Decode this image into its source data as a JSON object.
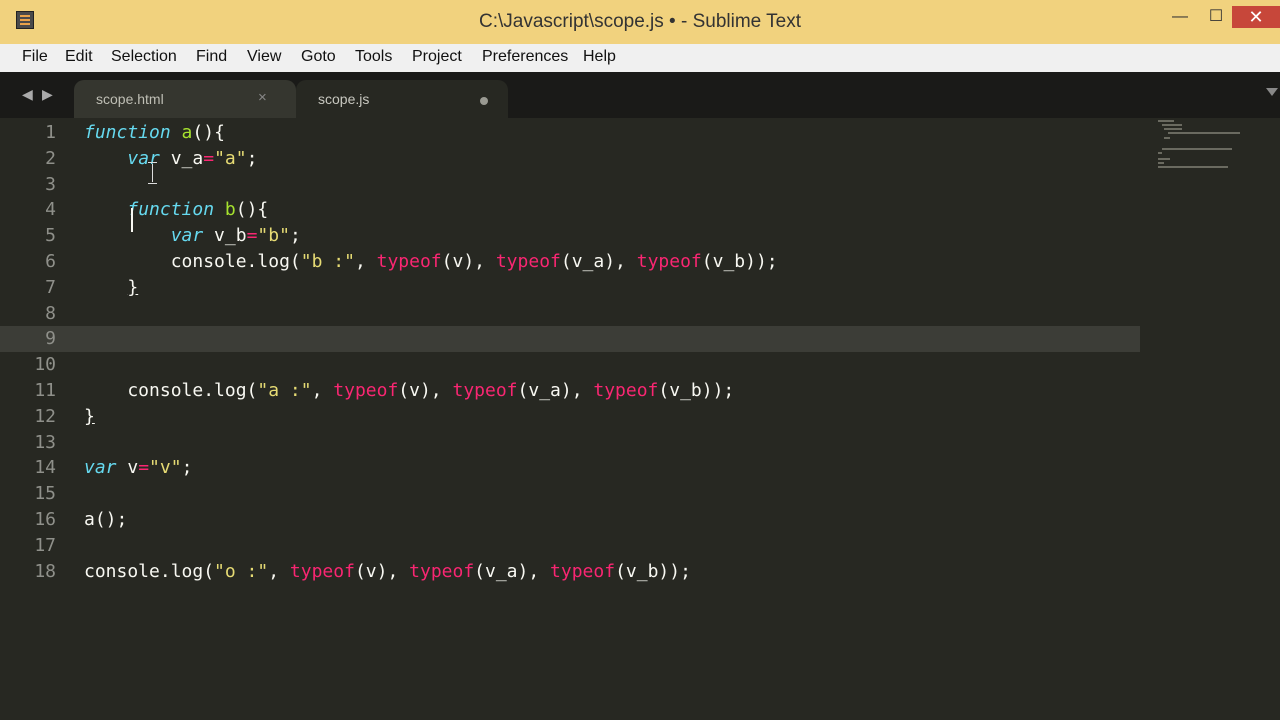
{
  "window": {
    "title": "C:\\Javascript\\scope.js • - Sublime Text",
    "buttons": {
      "minimize": "—",
      "maximize": "☐",
      "close": "✕"
    }
  },
  "menu": [
    "File",
    "Edit",
    "Selection",
    "Find",
    "View",
    "Goto",
    "Tools",
    "Project",
    "Preferences",
    "Help"
  ],
  "tabs": [
    {
      "label": "scope.html",
      "state": "saved",
      "close_glyph": "×"
    },
    {
      "label": "scope.js",
      "state": "modified"
    }
  ],
  "nav": {
    "back": "◀",
    "forward": "▶"
  },
  "editor": {
    "current_line": 9,
    "lines": [
      [
        {
          "t": "k",
          "v": "function"
        },
        {
          "t": "p",
          "v": " "
        },
        {
          "t": "f",
          "v": "a"
        },
        {
          "t": "p",
          "v": "(){"
        }
      ],
      [
        {
          "t": "p",
          "v": "    "
        },
        {
          "t": "k",
          "v": "var"
        },
        {
          "t": "p",
          "v": " v_a"
        },
        {
          "t": "o",
          "v": "="
        },
        {
          "t": "s",
          "v": "\"a\""
        },
        {
          "t": "p",
          "v": ";"
        }
      ],
      [],
      [
        {
          "t": "p",
          "v": "    "
        },
        {
          "t": "k",
          "v": "function"
        },
        {
          "t": "p",
          "v": " "
        },
        {
          "t": "f",
          "v": "b"
        },
        {
          "t": "p",
          "v": "(){"
        }
      ],
      [
        {
          "t": "p",
          "v": "        "
        },
        {
          "t": "k",
          "v": "var"
        },
        {
          "t": "p",
          "v": " v_b"
        },
        {
          "t": "o",
          "v": "="
        },
        {
          "t": "s",
          "v": "\"b\""
        },
        {
          "t": "p",
          "v": ";"
        }
      ],
      [
        {
          "t": "p",
          "v": "        console.log("
        },
        {
          "t": "s",
          "v": "\"b :\""
        },
        {
          "t": "p",
          "v": ", "
        },
        {
          "t": "o",
          "v": "typeof"
        },
        {
          "t": "p",
          "v": "(v), "
        },
        {
          "t": "o",
          "v": "typeof"
        },
        {
          "t": "p",
          "v": "(v_a), "
        },
        {
          "t": "o",
          "v": "typeof"
        },
        {
          "t": "p",
          "v": "(v_b));"
        }
      ],
      [
        {
          "t": "p",
          "v": "    "
        },
        {
          "t": "u",
          "v": "}"
        }
      ],
      [],
      [],
      [],
      [
        {
          "t": "p",
          "v": "    console.log("
        },
        {
          "t": "s",
          "v": "\"a :\""
        },
        {
          "t": "p",
          "v": ", "
        },
        {
          "t": "o",
          "v": "typeof"
        },
        {
          "t": "p",
          "v": "(v), "
        },
        {
          "t": "o",
          "v": "typeof"
        },
        {
          "t": "p",
          "v": "(v_a), "
        },
        {
          "t": "o",
          "v": "typeof"
        },
        {
          "t": "p",
          "v": "(v_b));"
        }
      ],
      [
        {
          "t": "u",
          "v": "}"
        }
      ],
      [],
      [
        {
          "t": "k",
          "v": "var"
        },
        {
          "t": "p",
          "v": " v"
        },
        {
          "t": "o",
          "v": "="
        },
        {
          "t": "s",
          "v": "\"v\""
        },
        {
          "t": "p",
          "v": ";"
        }
      ],
      [],
      [
        {
          "t": "p",
          "v": "a();"
        }
      ],
      [],
      [
        {
          "t": "p",
          "v": "console.log("
        },
        {
          "t": "s",
          "v": "\"o :\""
        },
        {
          "t": "p",
          "v": ", "
        },
        {
          "t": "o",
          "v": "typeof"
        },
        {
          "t": "p",
          "v": "(v), "
        },
        {
          "t": "o",
          "v": "typeof"
        },
        {
          "t": "p",
          "v": "(v_a), "
        },
        {
          "t": "o",
          "v": "typeof"
        },
        {
          "t": "p",
          "v": "(v_b));"
        }
      ]
    ]
  },
  "colors": {
    "editor_bg": "#272822",
    "keyword": "#66d9ef",
    "function_name": "#a6e22e",
    "string": "#e6db74",
    "operator": "#f92672",
    "titlebar": "#f1d27e"
  },
  "icons": {
    "app": "sublime-text-icon",
    "tab_close": "close-icon",
    "tab_modified": "modified-dot-icon",
    "tab_list": "chevron-down-icon"
  }
}
